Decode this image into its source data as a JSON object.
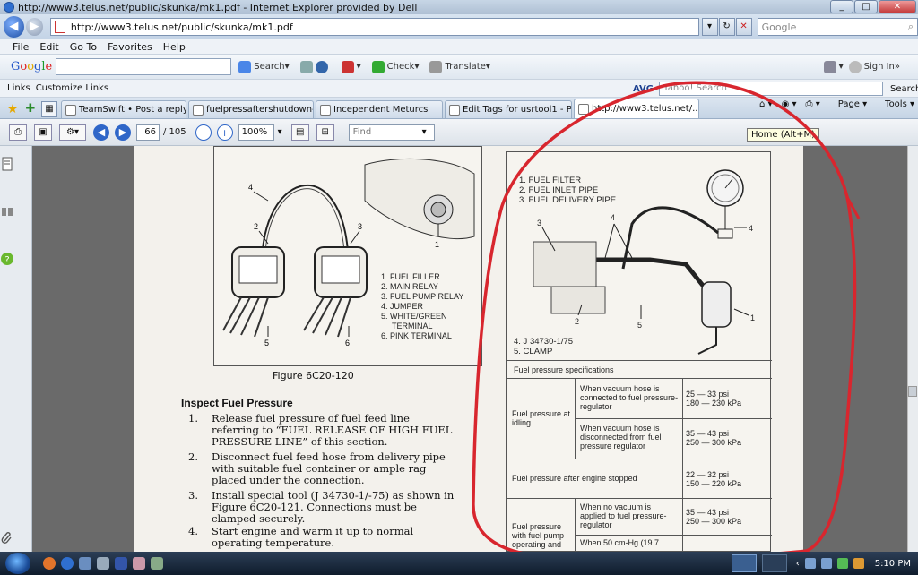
{
  "window": {
    "title": "http://www3.telus.net/public/skunka/mk1.pdf - Internet Explorer provided by Dell"
  },
  "address": {
    "url": "http://www3.telus.net/public/skunka/mk1.pdf",
    "search_placeholder": "Google"
  },
  "menu": [
    "File",
    "Edit",
    "Go To",
    "Favorites",
    "Help"
  ],
  "google_toolbar": {
    "logo": "Google",
    "search_label": "Search",
    "check_label": "Check",
    "translate_label": "Translate",
    "signin_label": "Sign In"
  },
  "links_bar": {
    "links_label": "Links",
    "customize": "Customize Links",
    "avg": "AVG",
    "yahoo_placeholder": "Yahoo! Search",
    "yahoo_search": "Search"
  },
  "tabs": [
    {
      "label": "TeamSwift • Post a reply",
      "active": false
    },
    {
      "label": "fuelpressaftershutdown-1...",
      "active": false
    },
    {
      "label": "Incependent Meturcs",
      "active": false
    },
    {
      "label": "Edit Tags for usrtool1 - Ph...",
      "active": false
    },
    {
      "label": "http://www3.telus.net/...",
      "active": true
    }
  ],
  "tab_tools": {
    "home_tooltip": "Home (Alt+M)",
    "page": "Page",
    "tools": "Tools"
  },
  "pdf_toolbar": {
    "page_current": "66",
    "page_total": "/ 105",
    "zoom": "100%",
    "find_placeholder": "Find"
  },
  "document": {
    "figure_left": {
      "labels": [
        "4",
        "2",
        "3",
        "1",
        "5",
        "6"
      ],
      "legend": [
        "1. FUEL FILLER",
        "2. MAIN RELAY",
        "3. FUEL PUMP RELAY",
        "4. JUMPER",
        "5. WHITE/GREEN",
        "TERMINAL",
        "6. PINK TERMINAL"
      ],
      "caption": "Figure 6C20-120"
    },
    "heading": "Inspect Fuel Pressure",
    "steps": [
      {
        "num": "1.",
        "text": "Release fuel pressure of fuel feed line referring to “FUEL RELEASE OF HIGH FUEL PRESSURE LINE” of this section."
      },
      {
        "num": "2.",
        "text": "Disconnect fuel feed hose from delivery pipe with suitable fuel container or ample rag placed under the connection."
      },
      {
        "num": "3.",
        "text": "Install special tool (J 34730-1/-75) as shown in Figure 6C20-121. Connections must be clamped securely."
      },
      {
        "num": "4.",
        "text": "Start engine and warm it up to normal operating temperature."
      }
    ],
    "figure_right": {
      "legend_top": [
        "1. FUEL FILTER",
        "2. FUEL INLET PIPE",
        "3. FUEL DELIVERY PIPE"
      ],
      "legend_bottom": [
        "4. J 34730-1/75",
        "5. CLAMP"
      ],
      "labels": [
        "3",
        "4",
        "4",
        "2",
        "5",
        "1"
      ]
    },
    "spec_table": {
      "title": "Fuel pressure specifications",
      "rows": [
        {
          "group": "Fuel pressure at idling",
          "cond": "When vacuum hose is connected to fuel pressure-regulator",
          "value": "25 — 33 psi",
          "value2": "180 — 230 kPa"
        },
        {
          "group": "",
          "cond": "When vacuum hose is disconnected from fuel pressure regulator",
          "value": "35 — 43 psi",
          "value2": "250 — 300 kPa"
        },
        {
          "group": "Fuel pressure after engine stopped",
          "cond": "",
          "value": "22 — 32 psi",
          "value2": "150 — 220 kPa"
        },
        {
          "group": "Fuel pressure with fuel pump operating and",
          "cond": "When no vacuum is applied to fuel pressure-regulator",
          "value": "35 — 43 psi",
          "value2": "250 — 300 kPa"
        },
        {
          "group": "",
          "cond": "When 50 cm-Hg (19.7",
          "value": "",
          "value2": ""
        }
      ]
    }
  },
  "taskbar": {
    "clock": "5:10 PM"
  },
  "colors": {
    "annotation": "#d8262e",
    "ie_blue": "#2f6fd0"
  }
}
